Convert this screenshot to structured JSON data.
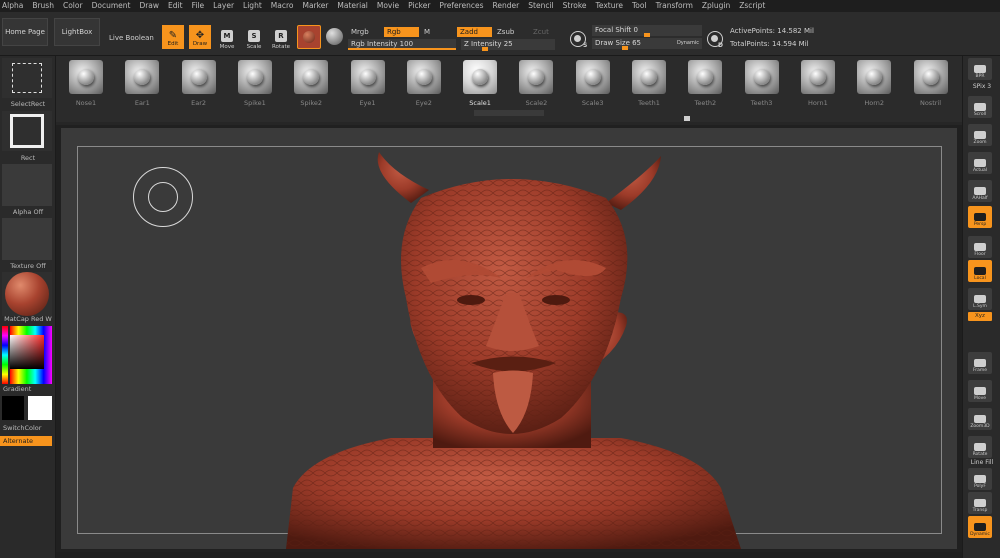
{
  "menu": [
    "Alpha",
    "Brush",
    "Color",
    "Document",
    "Draw",
    "Edit",
    "File",
    "Layer",
    "Light",
    "Macro",
    "Marker",
    "Material",
    "Movie",
    "Picker",
    "Preferences",
    "Render",
    "Stencil",
    "Stroke",
    "Texture",
    "Tool",
    "Transform",
    "Zplugin",
    "Zscript"
  ],
  "topshelf": {
    "home_page": "Home Page",
    "lightbox": "LightBox",
    "live_boolean": "Live Boolean",
    "edit": "Edit",
    "draw": "Draw",
    "move": "Move",
    "scale": "Scale",
    "rotate": "Rotate",
    "move_glyph": "M",
    "scale_glyph": "S",
    "rotate_glyph": "R",
    "mrgb": "Mrgb",
    "rgb": "Rgb",
    "m": "M",
    "zadd": "Zadd",
    "zsub": "Zsub",
    "zcut": "Zcut",
    "rgb_intensity": "Rgb Intensity 100",
    "z_intensity": "Z Intensity 25",
    "focal_shift": "Focal Shift 0",
    "draw_size": "Draw Size 65",
    "dynamic": "Dynamic",
    "s_letter": "S",
    "d_letter": "D",
    "active_points": "ActivePoints: 14.582 Mil",
    "total_points": "TotalPoints: 14.594 Mil",
    "rgb_intensity_level": 1.0,
    "z_intensity_level": 0.25,
    "focal_shift_level": 0.5,
    "draw_size_level": 0.3
  },
  "left": {
    "select_rect": "SelectRect",
    "rect": "Rect",
    "alpha_off": "Alpha Off",
    "texture_off": "Texture Off",
    "matcap": "MatCap Red W",
    "gradient": "Gradient",
    "switch_color": "SwitchColor",
    "alternate": "Alternate"
  },
  "brushes": [
    {
      "name": "Nose1"
    },
    {
      "name": "Ear1"
    },
    {
      "name": "Ear2"
    },
    {
      "name": "Spike1"
    },
    {
      "name": "Spike2"
    },
    {
      "name": "Eye1"
    },
    {
      "name": "Eye2"
    },
    {
      "name": "Scale1",
      "selected": true
    },
    {
      "name": "Scale2"
    },
    {
      "name": "Scale3"
    },
    {
      "name": "Teeth1"
    },
    {
      "name": "Teeth2"
    },
    {
      "name": "Teeth3"
    },
    {
      "name": "Horn1"
    },
    {
      "name": "Horn2"
    },
    {
      "name": "Nostril"
    }
  ],
  "right": {
    "bpr": "BPR",
    "spix": "SPix 3",
    "scroll": "Scroll",
    "zoom": "Zoom",
    "actual": "Actual",
    "aahalf": "AAHalf",
    "persp": "Persp",
    "floor": "Floor",
    "local": "Local",
    "lsym": "L.Sym",
    "xyz": "Xyz",
    "frame": "Frame",
    "move": "Move",
    "zoom3d": "Zoom3D",
    "rotate": "Rotate",
    "line_fill": "Line Fill",
    "polyf": "PolyF",
    "transp": "Transp",
    "dynamic": "Dynamic"
  },
  "colors": {
    "accent": "#f7941d",
    "model": "#a8432f",
    "canvas": "#3a3a3a"
  }
}
